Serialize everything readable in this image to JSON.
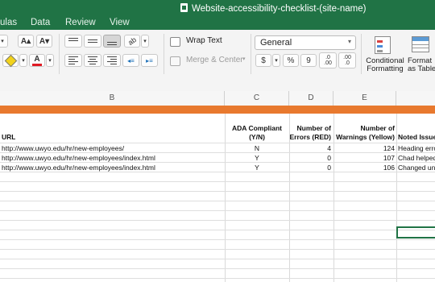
{
  "menu": [
    "ulas",
    "Data",
    "Review",
    "View"
  ],
  "window_title": "Website-accessibility-checklist-(site-name)",
  "ribbon": {
    "wrap_text": "Wrap Text",
    "merge_center": "Merge & Center",
    "font_name": "General",
    "currency": "$",
    "percent": "%",
    "comma": "9",
    "inc_decimal": ".0\n.00",
    "dec_decimal": ".00\n.0",
    "conditional_formatting": "Conditional\nFormatting",
    "format_as_table": "Format\nas Table",
    "font_size_inc": "A▴",
    "font_size_dec": "A▾",
    "font_color": "A"
  },
  "colors": {
    "ribbon_green": "#207345",
    "band_orange": "#e8792e",
    "font_color_bar": "#e01b24",
    "highlight": "#f2d21b"
  },
  "columns": [
    "B",
    "C",
    "D",
    "E"
  ],
  "table": {
    "headers": {
      "url": "URL",
      "ada": "ADA Compliant\n(Y/N)",
      "errors": "Number of\nErrors (RED)",
      "warnings": "Number of\nWarnings (Yellow)",
      "issues": "Noted Issue"
    },
    "rows": [
      {
        "url": "http://www.uwyo.edu/hr/new-employees/",
        "ada": "N",
        "errors": "4",
        "warnings": "124",
        "issues": "Heading erro"
      },
      {
        "url": "http://www.uwyo.edu/hr/new-employees/index.html",
        "ada": "Y",
        "errors": "0",
        "warnings": "107",
        "issues": "Chad helped"
      },
      {
        "url": "http://www.uwyo.edu/hr/new-employees/index.html",
        "ada": "Y",
        "errors": "0",
        "warnings": "106",
        "issues": "Changed und"
      }
    ]
  }
}
